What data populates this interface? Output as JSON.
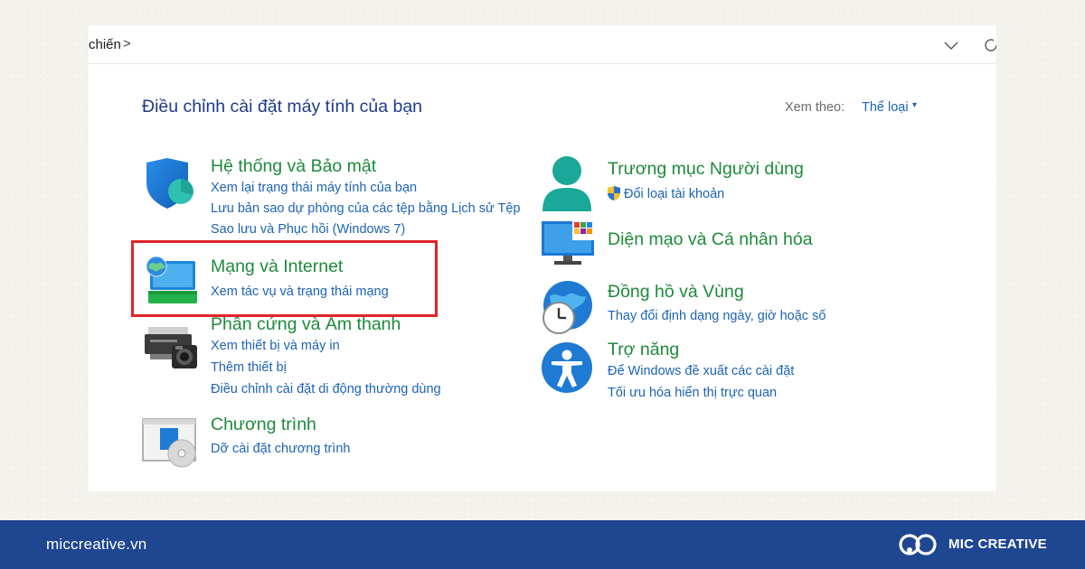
{
  "address_bar": {
    "breadcrumb": "chiến",
    "separator": ">"
  },
  "page": {
    "heading": "Điều chỉnh cài đặt máy tính của bạn",
    "view_by_label": "Xem theo:",
    "view_by_value": "Thể loại",
    "view_by_caret": "▾"
  },
  "left_categories": [
    {
      "title": "Hệ thống và Bảo mật",
      "icon": "security-shield-icon",
      "links": [
        "Xem lại trạng thái máy tính của bạn",
        "Lưu bản sao dự phòng của các tệp bằng Lịch sử Tệp",
        "Sao lưu và Phục hồi (Windows 7)"
      ]
    },
    {
      "title": "Mạng và Internet",
      "icon": "network-globe-icon",
      "links": [
        "Xem tác vụ và trạng thái mạng"
      ]
    },
    {
      "title": "Phần cứng và Âm thanh",
      "icon": "printer-camera-icon",
      "links": [
        "Xem thiết bị và máy in",
        "Thêm thiết bị",
        "Điều chỉnh cài đặt di động thường dùng"
      ]
    },
    {
      "title": "Chương trình",
      "icon": "programs-disc-icon",
      "links": [
        "Dỡ cài đặt chương trình"
      ]
    }
  ],
  "right_categories": [
    {
      "title": "Trương mục Người dùng",
      "icon": "user-accounts-icon",
      "links": [
        "Đổi loại tài khoản"
      ]
    },
    {
      "title": "Diện mạo và Cá nhân hóa",
      "icon": "appearance-monitor-icon",
      "links": []
    },
    {
      "title": "Đồng hồ và Vùng",
      "icon": "clock-globe-icon",
      "links": [
        "Thay đổi định dạng ngày, giờ hoặc số"
      ]
    },
    {
      "title": "Trợ năng",
      "icon": "accessibility-icon",
      "links": [
        "Để Windows đề xuất các cài đặt",
        "Tối ưu hóa hiển thị trực quan"
      ]
    }
  ],
  "footer": {
    "site": "miccreative.vn",
    "brand": "MIC CREATIVE"
  },
  "colors": {
    "category_title": "#1d8a3a",
    "link": "#1d63b4",
    "heading": "#1e3a8a",
    "highlight_box": "#e0242b",
    "footer_bg": "#1f4690"
  }
}
